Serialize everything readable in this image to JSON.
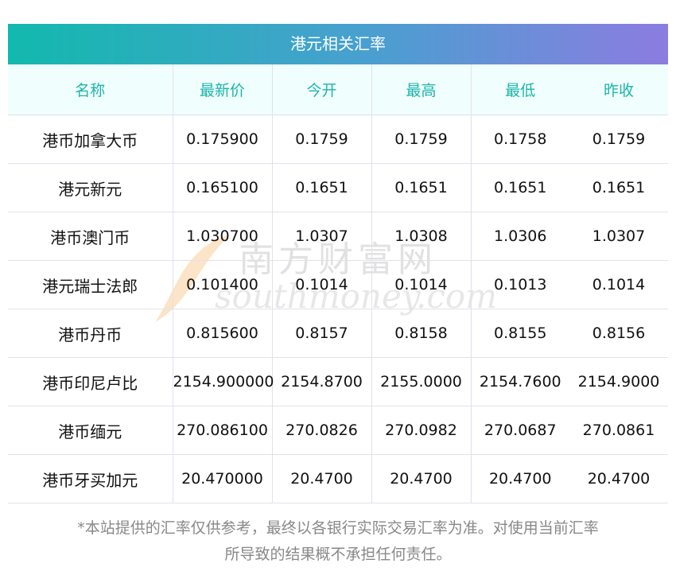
{
  "title": "港元相关汇率",
  "columns": [
    "名称",
    "最新价",
    "今开",
    "最高",
    "最低",
    "昨收"
  ],
  "rows": [
    [
      "港币加拿大币",
      "0.175900",
      "0.1759",
      "0.1759",
      "0.1758",
      "0.1759"
    ],
    [
      "港元新元",
      "0.165100",
      "0.1651",
      "0.1651",
      "0.1651",
      "0.1651"
    ],
    [
      "港币澳门币",
      "1.030700",
      "1.0307",
      "1.0308",
      "1.0306",
      "1.0307"
    ],
    [
      "港元瑞士法郎",
      "0.101400",
      "0.1014",
      "0.1014",
      "0.1013",
      "0.1014"
    ],
    [
      "港币丹币",
      "0.815600",
      "0.8157",
      "0.8158",
      "0.8155",
      "0.8156"
    ],
    [
      "港币印尼卢比",
      "2154.900000",
      "2154.8700",
      "2155.0000",
      "2154.7600",
      "2154.9000"
    ],
    [
      "港币缅元",
      "270.086100",
      "270.0826",
      "270.0982",
      "270.0687",
      "270.0861"
    ],
    [
      "港币牙买加元",
      "20.470000",
      "20.4700",
      "20.4700",
      "20.4700",
      "20.4700"
    ]
  ],
  "note_line1": "*本站提供的汇率仅供参考，最终以各银行实际交易汇率为准。对使用当前汇率",
  "note_line2": "所导致的结果概不承担任何责任。",
  "watermark": {
    "cn": "南方财富网",
    "en": "southmoney.com"
  },
  "colors": {
    "header_text": "#1bb5a8",
    "gradient_start": "#12b9ad",
    "gradient_end": "#8c7ce0"
  }
}
